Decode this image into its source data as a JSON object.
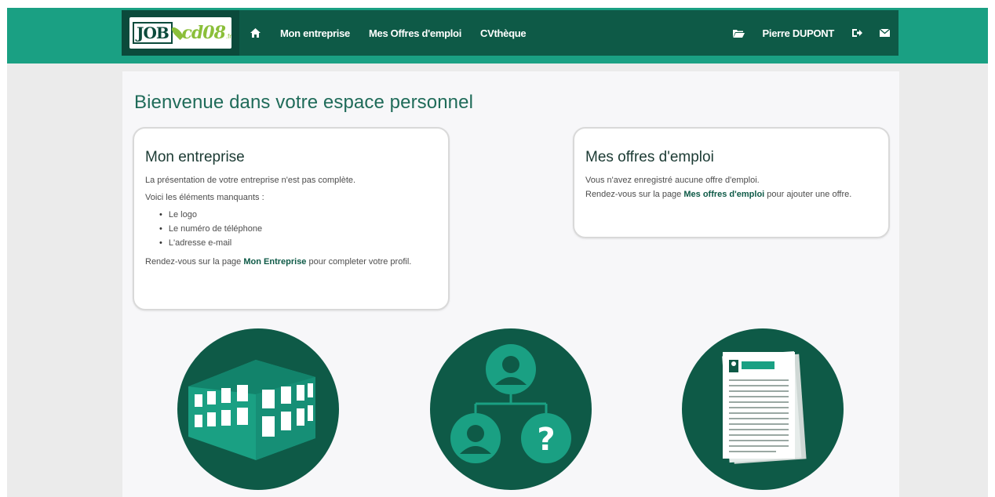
{
  "header": {
    "logo": {
      "job": "JOB",
      "cd08": "cd08",
      "tld": ".fr"
    },
    "nav": {
      "home_icon": "home-icon",
      "items": [
        {
          "label": "Mon entreprise"
        },
        {
          "label": "Mes Offres d'emploi"
        },
        {
          "label": "CVthèque"
        }
      ]
    },
    "right": {
      "folder_icon": "folder-icon",
      "user_name": "Pierre DUPONT",
      "logout_icon": "logout-icon",
      "mail_icon": "envelope-icon"
    }
  },
  "main": {
    "title": "Bienvenue dans votre espace personnel",
    "company_card": {
      "title": "Mon entreprise",
      "intro": "La présentation de votre entreprise n'est pas complète.",
      "missing_label": "Voici les éléments manquants :",
      "missing_items": [
        "Le logo",
        "Le numéro de téléphone",
        "L'adresse e-mail"
      ],
      "cta_prefix": "Rendez-vous sur la page ",
      "cta_link": "Mon Entreprise",
      "cta_suffix": " pour completer votre profil."
    },
    "offers_card": {
      "title": "Mes offres d'emploi",
      "line1": "Vous n'avez enregistré aucune offre d'emploi.",
      "cta_prefix": "Rendez-vous sur la page ",
      "cta_link": "Mes offres d'emploi",
      "cta_suffix": " pour ajouter une offre."
    },
    "tiles": [
      {
        "icon": "building-icon"
      },
      {
        "icon": "org-chart-icon"
      },
      {
        "icon": "resume-document-icon"
      }
    ]
  },
  "colors": {
    "brand_teal": "#1aa083",
    "brand_dark": "#0e5a47",
    "brand_lime": "#8bbf3a",
    "title_text": "#1f6b59"
  }
}
